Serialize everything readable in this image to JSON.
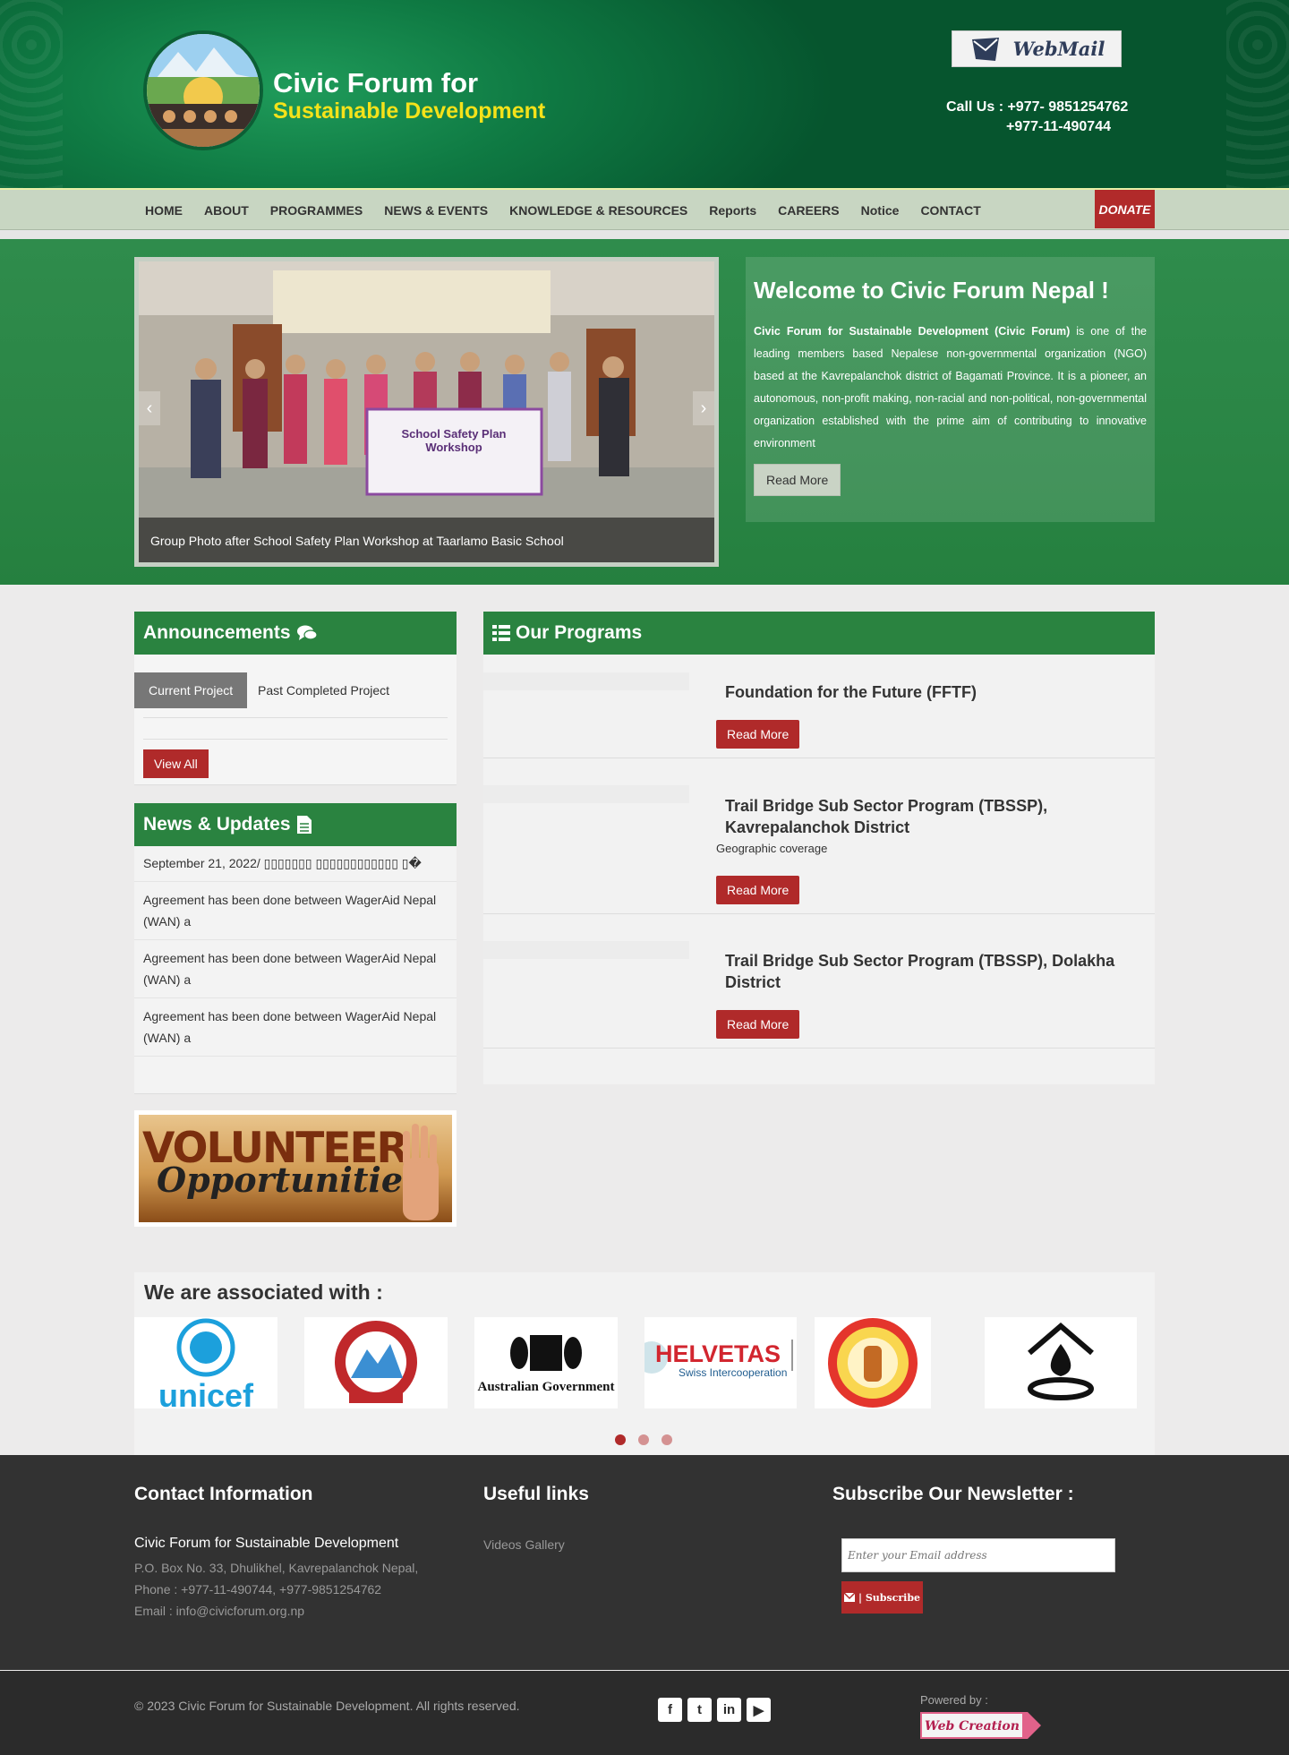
{
  "header": {
    "title_line1": "Civic Forum for",
    "title_line2": "Sustainable Development",
    "webmail_label": "WebMail",
    "call_line1": "Call Us : +977- 9851254762",
    "call_line2": "+977-11-490744"
  },
  "nav": {
    "items": [
      "HOME",
      "ABOUT",
      "PROGRAMMES",
      "NEWS & EVENTS",
      "KNOWLEDGE & RESOURCES",
      "Reports",
      "CAREERS",
      "Notice",
      "CONTACT"
    ],
    "donate_label": "DONATE"
  },
  "slider": {
    "caption": "Group Photo after School Safety Plan Workshop at Taarlamo Basic School",
    "banner_text": "School Safety Plan Workshop",
    "prev_label": "‹",
    "next_label": "›"
  },
  "welcome": {
    "heading": "Welcome to Civic Forum Nepal !",
    "org_name": "Civic Forum for Sustainable Development (Civic Forum)",
    "body": " is one of the leading members based Nepalese non-governmental organization (NGO) based at the Kavrepalanchok district of Bagamati Province. It is a pioneer, an autonomous, non-profit making, non-racial and non-political, non-governmental organization established with the prime aim of contributing to innovative environment",
    "read_more": "Read More"
  },
  "announcements": {
    "heading": "Announcements",
    "tab_current": "Current Project",
    "tab_past": "Past Completed Project",
    "view_all": "View All"
  },
  "news": {
    "heading": "News & Updates",
    "date_line": "September 21, 2022/ ▯▯▯▯▯▯▯ ▯▯▯▯▯▯▯▯▯▯▯▯ ▯�",
    "items": [
      "Agreement has been done between WagerAid Nepal (WAN) a",
      "Agreement has been done between WagerAid Nepal (WAN) a",
      "Agreement has been done between WagerAid Nepal (WAN) a"
    ]
  },
  "volunteer": {
    "line1": "VOLUNTEER",
    "line2": "Opportunities"
  },
  "programs": {
    "heading": "Our Programs",
    "items": [
      {
        "title": "Foundation for the Future (FFTF)",
        "subtitle": "",
        "read_more": "Read More"
      },
      {
        "title": "Trail Bridge Sub Sector Program (TBSSP), Kavrepalanchok District",
        "subtitle": "Geographic coverage",
        "read_more": "Read More"
      },
      {
        "title": "Trail Bridge Sub Sector Program (TBSSP), Dolakha District",
        "subtitle": "",
        "read_more": "Read More"
      }
    ]
  },
  "associated": {
    "heading": "We are associated with :",
    "logos": [
      "unicef",
      "Australian Government",
      "HELVETAS",
      "Swiss Intercooperation"
    ]
  },
  "footer": {
    "contact_heading": "Contact Information",
    "org_name": "Civic Forum for Sustainable Development",
    "address": "P.O. Box No. 33, Dhulikhel, Kavrepalanchok Nepal,",
    "phone": "Phone : +977-11-490744, +977-9851254762",
    "email": "Email : info@civicforum.org.np",
    "links_heading": "Useful links",
    "link_videos": "Videos Gallery",
    "newsletter_heading": "Subscribe Our Newsletter :",
    "newsletter_placeholder": "Enter your Email address",
    "subscribe_label": "| Subscribe",
    "copyright": "© 2023 Civic Forum for Sustainable Development. All rights reserved.",
    "powered_by": "Powered by :",
    "powered_logo_text": "Web Creation"
  },
  "colors": {
    "primary_green": "#2a8340",
    "accent_red": "#b02a2a",
    "footer_bg": "#323232",
    "title_yellow": "#f4e21a"
  }
}
